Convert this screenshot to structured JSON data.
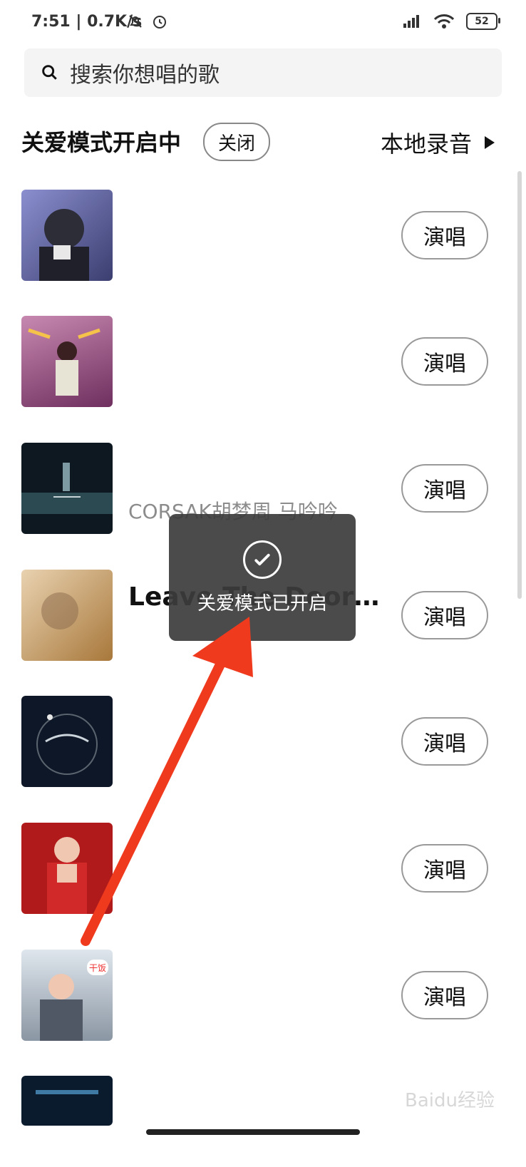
{
  "status_bar": {
    "time": "7:51 | 0.7K/s",
    "battery": "52"
  },
  "search": {
    "placeholder": "搜索你想唱的歌"
  },
  "care_mode": {
    "title": "关爱模式开启中",
    "close_label": "关闭",
    "local_recording_label": "本地录音"
  },
  "songs": [
    {
      "title": "",
      "artist": "",
      "sing_label": "演唱",
      "cover_color": "#6b6ea8"
    },
    {
      "title": "",
      "artist": "",
      "sing_label": "演唱",
      "cover_color": "#b5658f"
    },
    {
      "title": "",
      "artist": "",
      "sing_label": "演唱",
      "cover_color": "#0f1a22"
    },
    {
      "title": "Leave The Door O…",
      "artist": "",
      "sing_label": "演唱",
      "cover_color": "#c59b6a"
    },
    {
      "title": "",
      "artist": "",
      "sing_label": "演唱",
      "cover_color": "#0e1727"
    },
    {
      "title": "",
      "artist": "",
      "sing_label": "演唱",
      "cover_color": "#b01a1a"
    },
    {
      "title": "",
      "artist": "",
      "sing_label": "演唱",
      "cover_color": "#9aa6b2"
    },
    {
      "title": "",
      "artist": "",
      "sing_label": "",
      "cover_color": "#0b1b2e"
    }
  ],
  "ghost_text": "CORSAK胡梦周 马吟吟",
  "toast": {
    "message": "关爱模式已开启"
  },
  "watermark": "Baidu经验",
  "colors": {
    "arrow": "#f03a1e",
    "toast_bg": "#3c3c3c"
  }
}
